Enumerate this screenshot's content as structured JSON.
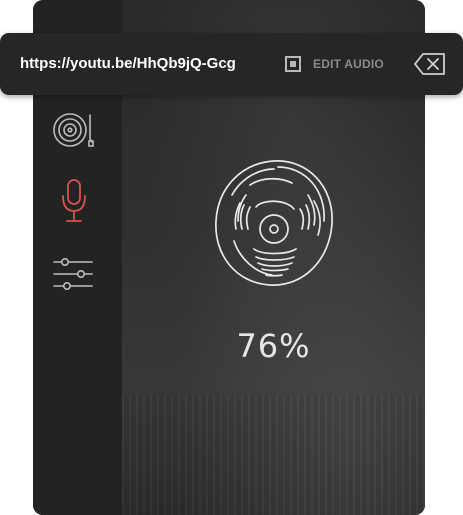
{
  "topbar": {
    "url": "https://youtu.be/HhQb9jQ-Gcg",
    "edit_audio_label": "EDIT AUDIO"
  },
  "sidebar": {
    "items": [
      {
        "icon": "turntable-icon",
        "active": false
      },
      {
        "icon": "microphone-icon",
        "active": true
      },
      {
        "icon": "sliders-icon",
        "active": false
      }
    ]
  },
  "progress": {
    "percent_label": "76%",
    "value": 0.76
  },
  "colors": {
    "accent": "#d9534f",
    "icon": "#bdbdbd",
    "panel": "#2b2b2b",
    "sidebar": "#232323",
    "topbar": "#262626"
  }
}
